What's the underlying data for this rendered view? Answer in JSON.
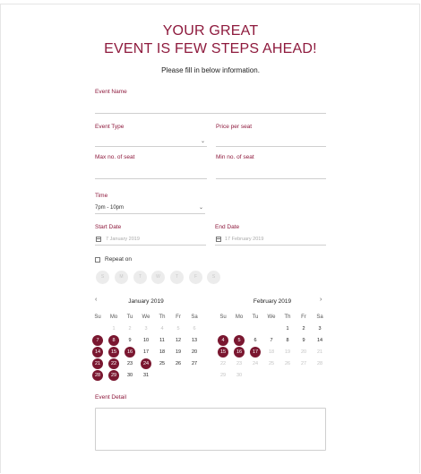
{
  "header": {
    "title_line1": "YOUR GREAT",
    "title_line2": "EVENT IS FEW STEPS AHEAD!",
    "subtitle": "Please fill in below information."
  },
  "form": {
    "event_name_label": "Event Name",
    "event_type_label": "Event Type",
    "price_label": "Price per seat",
    "max_seat_label": "Max no. of seat",
    "min_seat_label": "Min no. of seat",
    "time_label": "Time",
    "time_value": "7pm - 10pm",
    "start_date_label": "Start Date",
    "start_date_placeholder": "7 January 2019",
    "end_date_label": "End Date",
    "end_date_placeholder": "17 February 2019",
    "repeat_label": "Repeat on",
    "weekdays": [
      "S",
      "M",
      "T",
      "W",
      "T",
      "F",
      "S"
    ],
    "event_detail_label": "Event Detail"
  },
  "calendar": {
    "prev_icon": "‹",
    "next_icon": "›",
    "day_headers": [
      "Su",
      "Mo",
      "Tu",
      "We",
      "Th",
      "Fr",
      "Sa"
    ],
    "months": [
      {
        "name": "January 2019",
        "weeks": [
          [
            "",
            "1",
            "2",
            "3",
            "4",
            "5",
            "6"
          ],
          [
            "7",
            "8",
            "9",
            "10",
            "11",
            "12",
            "13"
          ],
          [
            "14",
            "15",
            "16",
            "17",
            "18",
            "19",
            "20"
          ],
          [
            "21",
            "22",
            "23",
            "24",
            "25",
            "26",
            "27"
          ],
          [
            "28",
            "29",
            "30",
            "31",
            "",
            "",
            ""
          ]
        ],
        "muted": [
          "1",
          "2",
          "3",
          "4",
          "5",
          "6"
        ],
        "selected": [
          "7",
          "8",
          "14",
          "15",
          "16",
          "21",
          "22",
          "24",
          "28",
          "29"
        ]
      },
      {
        "name": "February 2019",
        "weeks": [
          [
            "",
            "",
            "",
            "",
            "1",
            "2",
            "3"
          ],
          [
            "4",
            "5",
            "6",
            "7",
            "8",
            "9",
            "14"
          ],
          [
            "15",
            "16",
            "17",
            "18",
            "19",
            "20",
            "21"
          ],
          [
            "22",
            "23",
            "24",
            "25",
            "26",
            "27",
            "28"
          ],
          [
            "29",
            "30",
            "",
            "",
            "",
            "",
            ""
          ]
        ],
        "muted": [
          "18",
          "19",
          "20",
          "21",
          "22",
          "23",
          "24",
          "25",
          "26",
          "27",
          "28",
          "29",
          "30"
        ],
        "selected": [
          "4",
          "5",
          "15",
          "16",
          "17"
        ]
      }
    ]
  },
  "colors": {
    "accent": "#8e1a3d",
    "selected_day": "#7a1730"
  }
}
